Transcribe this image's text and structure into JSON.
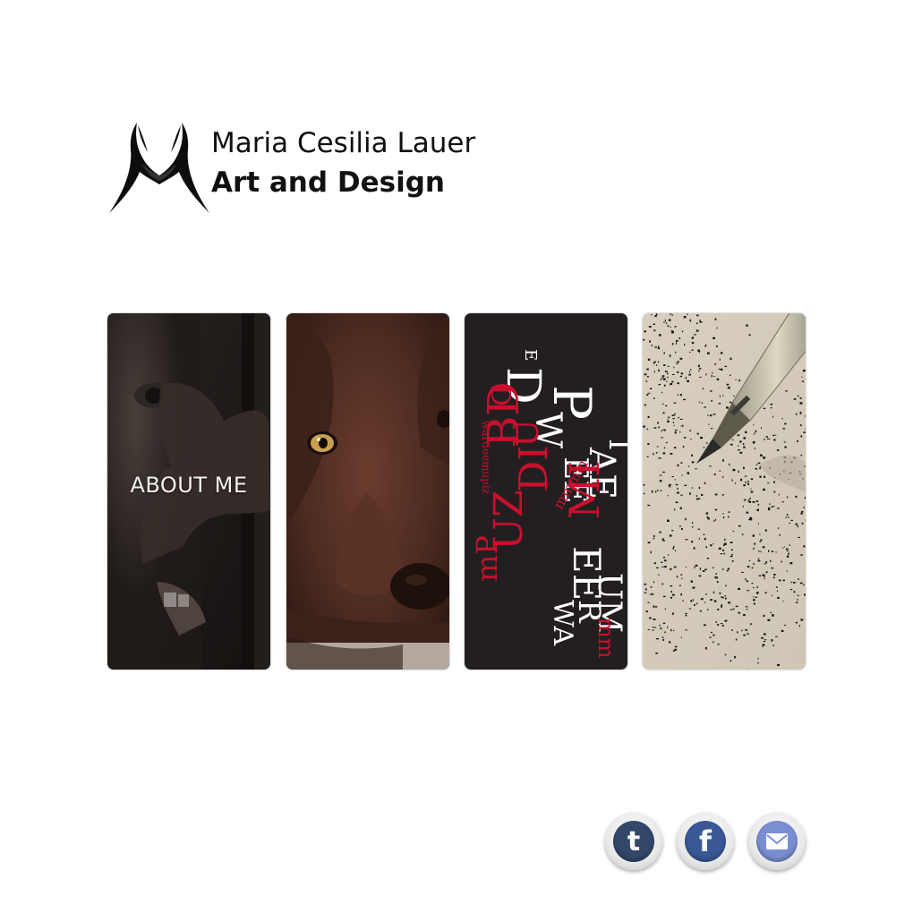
{
  "header": {
    "name": "Maria Cesilia Lauer",
    "tagline": "Art and Design",
    "logo_icon": "mcl-monogram-logo"
  },
  "tiles": [
    {
      "label": "ABOUT ME",
      "image": "child-peeking-photo"
    },
    {
      "label": "",
      "image": "brown-dog-painting"
    },
    {
      "label": "",
      "image": "typographic-figure-artwork"
    },
    {
      "label": "",
      "image": "pen-stippling-drawing"
    }
  ],
  "social": [
    {
      "name": "tumblr",
      "glyph": "t",
      "icon": "tumblr-icon",
      "color": "#33476a"
    },
    {
      "name": "facebook",
      "glyph": "f",
      "icon": "facebook-icon",
      "color": "#3a5896"
    },
    {
      "name": "email",
      "glyph": "",
      "icon": "mail-icon",
      "color": "#7a8ed2"
    }
  ],
  "colors": {
    "background": "#ffffff",
    "text": "#111111",
    "accent_red": "#c8102e"
  }
}
